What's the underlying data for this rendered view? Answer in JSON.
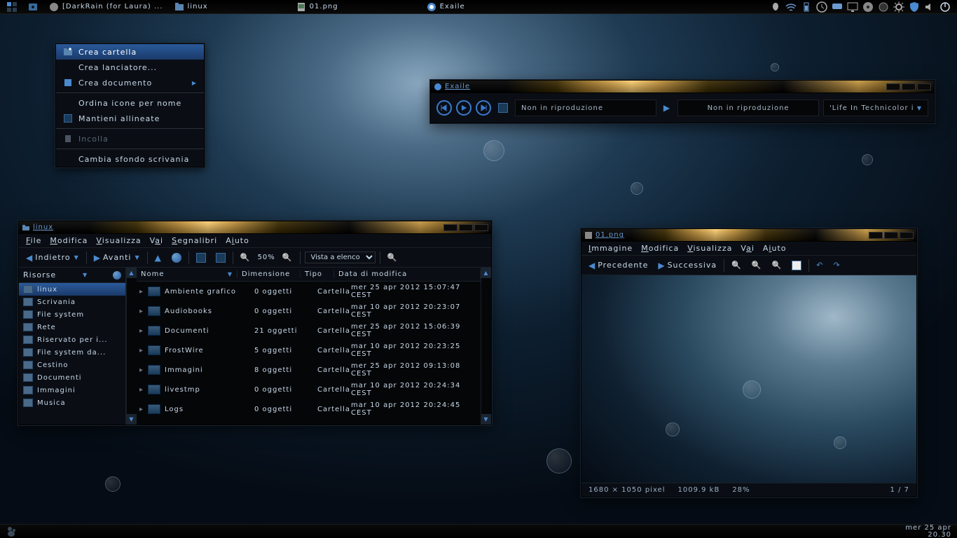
{
  "topbar": {
    "tasks": [
      {
        "name": "show-desktop",
        "label": ""
      },
      {
        "name": "task-darkrain",
        "label": "[DarkRain (for Laura) ..."
      },
      {
        "name": "task-linux",
        "label": "linux"
      },
      {
        "name": "task-01png",
        "label": "01.png"
      },
      {
        "name": "task-exaile",
        "label": "Exaile"
      }
    ]
  },
  "bottombar": {
    "date": "mer 25 apr",
    "time": "20.30"
  },
  "context_menu": {
    "items": [
      {
        "label": "Crea cartella",
        "icon": "folder-plus",
        "hi": true
      },
      {
        "label": "Crea lanciatore...",
        "icon": ""
      },
      {
        "label": "Crea documento",
        "icon": "document",
        "sub": true
      },
      {
        "sep": true
      },
      {
        "label": "Ordina icone per nome",
        "icon": ""
      },
      {
        "label": "Mantieni allineate",
        "icon": "checkbox"
      },
      {
        "sep": true
      },
      {
        "label": "Incolla",
        "icon": "paste",
        "dis": true
      },
      {
        "sep": true
      },
      {
        "label": "Cambia sfondo scrivania",
        "icon": ""
      }
    ]
  },
  "exaile": {
    "title": "Exaile",
    "status1": "Non in riproduzione",
    "status2": "Non in riproduzione",
    "track": "'Life In Technicolor i"
  },
  "filemgr": {
    "title": "linux",
    "menus": [
      "File",
      "Modifica",
      "Visualizza",
      "Vai",
      "Segnalibri",
      "Aiuto"
    ],
    "toolbar": {
      "back": "Indietro",
      "fwd": "Avanti",
      "zoom": "50%",
      "view": "Vista a elenco"
    },
    "side_label": "Risorse",
    "places": [
      {
        "label": "linux",
        "sel": true
      },
      {
        "label": "Scrivania"
      },
      {
        "label": "File system"
      },
      {
        "label": "Rete"
      },
      {
        "label": "Riservato per i..."
      },
      {
        "label": "File system da..."
      },
      {
        "label": "Cestino"
      },
      {
        "label": "Documenti"
      },
      {
        "label": "Immagini"
      },
      {
        "label": "Musica"
      }
    ],
    "cols": {
      "name": "Nome",
      "dim": "Dimensione",
      "typ": "Tipo",
      "mod": "Data di modifica"
    },
    "rows": [
      {
        "name": "Ambiente grafico",
        "dim": "0 oggetti",
        "typ": "Cartella",
        "mod": "mer 25 apr 2012  15:07:47 CEST"
      },
      {
        "name": "Audiobooks",
        "dim": "0 oggetti",
        "typ": "Cartella",
        "mod": "mar 10 apr 2012  20:23:07 CEST"
      },
      {
        "name": "Documenti",
        "dim": "21 oggetti",
        "typ": "Cartella",
        "mod": "mer 25 apr 2012  15:06:39 CEST"
      },
      {
        "name": "FrostWire",
        "dim": "5 oggetti",
        "typ": "Cartella",
        "mod": "mar 10 apr 2012  20:23:25 CEST"
      },
      {
        "name": "Immagini",
        "dim": "8 oggetti",
        "typ": "Cartella",
        "mod": "mer 25 apr 2012  09:13:08 CEST"
      },
      {
        "name": "livestmp",
        "dim": "0 oggetti",
        "typ": "Cartella",
        "mod": "mar 10 apr 2012  20:24:34 CEST"
      },
      {
        "name": "Logs",
        "dim": "0 oggetti",
        "typ": "Cartella",
        "mod": "mar 10 apr 2012  20:24:45 CEST"
      }
    ]
  },
  "imgview": {
    "title": "01.png",
    "menus": [
      "Immagine",
      "Modifica",
      "Visualizza",
      "Vai",
      "Aiuto"
    ],
    "toolbar": {
      "prev": "Precedente",
      "next": "Successiva"
    },
    "status": {
      "dims": "1680 × 1050 pixel",
      "size": "1009.9 kB",
      "zoom": "28%",
      "page": "1 / 7"
    }
  }
}
